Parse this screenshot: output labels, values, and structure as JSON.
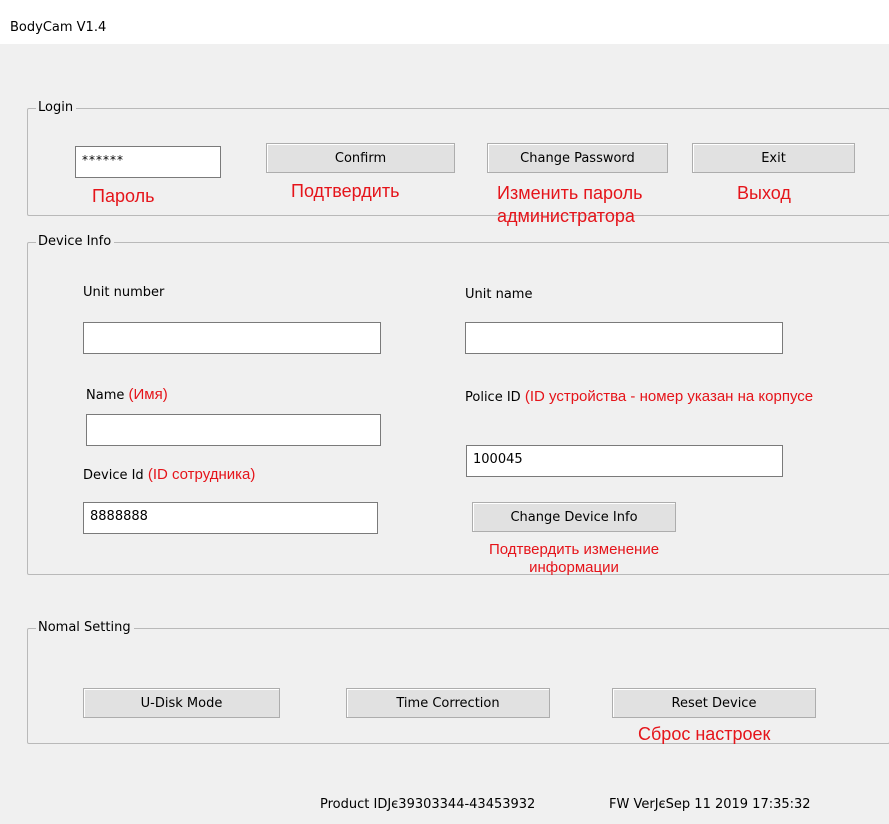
{
  "window": {
    "title": "BodyCam V1.4"
  },
  "login": {
    "legend": "Login",
    "password_value": "******",
    "confirm_label": "Confirm",
    "change_password_label": "Change Password",
    "exit_label": "Exit",
    "annotations": {
      "password": "Пароль",
      "confirm": "Подтвердить",
      "change_password_line1": "Изменить пароль",
      "change_password_line2": "администратора",
      "exit": "Выход"
    }
  },
  "device_info": {
    "legend": "Device Info",
    "unit_number_label": "Unit number",
    "unit_number_value": "",
    "unit_name_label": "Unit name",
    "unit_name_value": "",
    "name_label": "Name",
    "name_annotation": "(Имя)",
    "name_value": "",
    "police_id_label": "Police ID",
    "police_id_annotation": "(ID устройства - номер указан на корпусе",
    "police_id_value": "100045",
    "device_id_label": "Device Id",
    "device_id_annotation": "(ID сотрудника)",
    "device_id_value": "8888888",
    "change_button_label": "Change Device Info",
    "change_annotation_line1": "Подтвердить изменение",
    "change_annotation_line2": "информации"
  },
  "normal_setting": {
    "legend": "Nomal Setting",
    "udisk_label": "U-Disk Mode",
    "time_correction_label": "Time Correction",
    "reset_label": "Reset Device",
    "reset_annotation": "Сброс настроек"
  },
  "status_bar": {
    "product_id": "Product IDЈє39303344-43453932",
    "fw_version": "FW VerЈєSep 11 2019 17:35:32"
  }
}
